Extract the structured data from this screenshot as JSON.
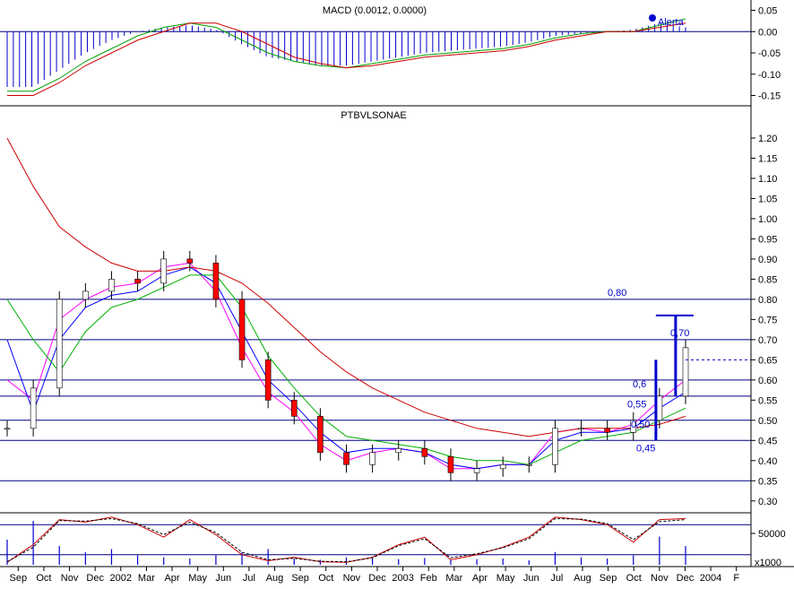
{
  "colors": {
    "background": "#ffffff",
    "frame": "#000000",
    "level_line": "#000080",
    "annotation": "#0000cc",
    "bull_candle": "#ffffff",
    "bear_candle": "#ff0000",
    "ma_fast": "#ff00ff",
    "ma_blue": "#0000ff",
    "ma_green": "#00b000",
    "ma_long": "#cc0000",
    "macd_hist": "#0000cc",
    "macd_line": "#00a000",
    "macd_signal": "#cc0000",
    "stoch_k": "#cc0000",
    "stoch_d": "#000000",
    "volume": "#0000cc"
  },
  "macd_panel": {
    "title": "MACD (0.0012, 0.0000)",
    "legend_marker": "Alerta",
    "axis_ticks": [
      "0.05",
      "0.00",
      "-0.05",
      "-0.10",
      "-0.15"
    ],
    "ylim": [
      -0.17,
      0.07
    ]
  },
  "price_panel": {
    "title": "PTBVLSONAE",
    "axis_ticks": [
      "1.20",
      "1.15",
      "1.10",
      "1.05",
      "1.00",
      "0.95",
      "0.90",
      "0.85",
      "0.80",
      "0.75",
      "0.70",
      "0.65",
      "0.60",
      "0.55",
      "0.50",
      "0.45",
      "0.40",
      "0.35",
      "0.30"
    ],
    "ylim": [
      0.275,
      1.24
    ],
    "annotations": [
      {
        "text": "0,80",
        "y": 0.8,
        "where": "right-of-breakout"
      },
      {
        "text": "0,70",
        "y": 0.7,
        "where": "last-candle"
      },
      {
        "text": "0,45",
        "y": 0.45,
        "where": "below-breakout"
      },
      {
        "text": "0,50",
        "y": 0.5,
        "where": "breakout"
      },
      {
        "text": "0,55",
        "y": 0.55,
        "where": "breakout"
      },
      {
        "text": "0,6",
        "y": 0.6,
        "where": "breakout"
      }
    ]
  },
  "stoch_panel": {
    "axis_ticks": [
      "50000"
    ],
    "multiplier": "x1000"
  },
  "time_axis": {
    "labels": [
      "Sep",
      "Oct",
      "Nov",
      "Dec",
      "2002",
      "Mar",
      "Apr",
      "May",
      "Jun",
      "Jul",
      "Aug",
      "Sep",
      "Oct",
      "Nov",
      "Dec",
      "2003",
      "Feb",
      "Mar",
      "Apr",
      "May",
      "Jun",
      "Jul",
      "Aug",
      "Sep",
      "Oct",
      "Nov",
      "Dec",
      "2004",
      "F"
    ]
  },
  "chart_data": [
    {
      "type": "bar",
      "name": "MACD",
      "x": [
        "2001-09",
        "2001-10",
        "2001-11",
        "2001-12",
        "2002-01",
        "2002-02",
        "2002-03",
        "2002-04",
        "2002-05",
        "2002-06",
        "2002-07",
        "2002-08",
        "2002-09",
        "2002-10",
        "2002-11",
        "2002-12",
        "2003-01",
        "2003-02",
        "2003-03",
        "2003-04",
        "2003-05",
        "2003-06",
        "2003-07",
        "2003-08",
        "2003-09",
        "2003-10",
        "2003-11"
      ],
      "series": [
        {
          "values": [
            -0.13,
            -0.13,
            -0.09,
            -0.05,
            -0.02,
            0.0,
            0.01,
            0.015,
            0.005,
            -0.03,
            -0.06,
            -0.07,
            -0.08,
            -0.08,
            -0.07,
            -0.06,
            -0.05,
            -0.045,
            -0.04,
            -0.035,
            -0.025,
            -0.01,
            -0.005,
            0.0,
            0.005,
            0.02,
            0.01
          ]
        },
        {
          "values": [
            -0.14,
            -0.14,
            -0.11,
            -0.07,
            -0.04,
            -0.01,
            0.01,
            0.02,
            0.01,
            -0.02,
            -0.05,
            -0.07,
            -0.08,
            -0.085,
            -0.075,
            -0.065,
            -0.055,
            -0.05,
            -0.045,
            -0.04,
            -0.03,
            -0.015,
            -0.005,
            0.0,
            0.0,
            0.015,
            0.03
          ]
        },
        {
          "values": [
            -0.15,
            -0.15,
            -0.12,
            -0.08,
            -0.05,
            -0.02,
            0.0,
            0.02,
            0.02,
            0.0,
            -0.03,
            -0.06,
            -0.075,
            -0.085,
            -0.08,
            -0.07,
            -0.06,
            -0.055,
            -0.05,
            -0.045,
            -0.035,
            -0.02,
            -0.01,
            0.0,
            0.0,
            0.01,
            0.02
          ]
        }
      ]
    },
    {
      "type": "line",
      "name": "PTBVLSONAE",
      "x": [
        "2001-09",
        "2001-10",
        "2001-11",
        "2001-12",
        "2002-01",
        "2002-02",
        "2002-03",
        "2002-04",
        "2002-05",
        "2002-06",
        "2002-07",
        "2002-08",
        "2002-09",
        "2002-10",
        "2002-11",
        "2002-12",
        "2003-01",
        "2003-02",
        "2003-03",
        "2003-04",
        "2003-05",
        "2003-06",
        "2003-07",
        "2003-08",
        "2003-09",
        "2003-10",
        "2003-11"
      ],
      "series": [
        {
          "name": "",
          "values": [
            0.48,
            0.58,
            0.8,
            0.82,
            0.85,
            0.84,
            0.9,
            0.89,
            0.8,
            0.65,
            0.55,
            0.51,
            0.42,
            0.39,
            0.42,
            0.43,
            0.41,
            0.37,
            0.38,
            0.39,
            0.39,
            0.48,
            0.48,
            0.47,
            0.5,
            0.56,
            0.68
          ]
        },
        {
          "values": [
            0.6,
            0.55,
            0.75,
            0.8,
            0.83,
            0.84,
            0.88,
            0.89,
            0.82,
            0.68,
            0.57,
            0.52,
            0.44,
            0.4,
            0.42,
            0.43,
            0.42,
            0.38,
            0.38,
            0.39,
            0.39,
            0.47,
            0.48,
            0.47,
            0.49,
            0.55,
            0.6
          ]
        },
        {
          "values": [
            0.7,
            0.52,
            0.7,
            0.78,
            0.81,
            0.82,
            0.86,
            0.88,
            0.84,
            0.72,
            0.6,
            0.54,
            0.47,
            0.42,
            0.43,
            0.43,
            0.42,
            0.39,
            0.38,
            0.39,
            0.39,
            0.45,
            0.47,
            0.47,
            0.48,
            0.53,
            0.57
          ]
        },
        {
          "values": [
            0.8,
            0.7,
            0.62,
            0.72,
            0.78,
            0.8,
            0.83,
            0.86,
            0.86,
            0.78,
            0.66,
            0.58,
            0.51,
            0.46,
            0.45,
            0.44,
            0.43,
            0.41,
            0.4,
            0.4,
            0.39,
            0.42,
            0.45,
            0.46,
            0.47,
            0.5,
            0.53
          ]
        },
        {
          "values": [
            1.2,
            1.08,
            0.98,
            0.93,
            0.89,
            0.87,
            0.87,
            0.88,
            0.87,
            0.84,
            0.79,
            0.73,
            0.67,
            0.62,
            0.58,
            0.55,
            0.52,
            0.5,
            0.48,
            0.47,
            0.46,
            0.47,
            0.48,
            0.48,
            0.48,
            0.49,
            0.51
          ]
        }
      ],
      "levels": [
        0.8,
        0.7,
        0.6,
        0.56,
        0.5,
        0.45,
        0.35
      ],
      "ylim": [
        0.275,
        1.24
      ]
    },
    {
      "type": "line",
      "name": "Stochastic",
      "x": [
        "2001-09",
        "2001-10",
        "2001-11",
        "2001-12",
        "2002-01",
        "2002-02",
        "2002-03",
        "2002-04",
        "2002-05",
        "2002-06",
        "2002-07",
        "2002-08",
        "2002-09",
        "2002-10",
        "2002-11",
        "2002-12",
        "2003-01",
        "2003-02",
        "2003-03",
        "2003-04",
        "2003-05",
        "2003-06",
        "2003-07",
        "2003-08",
        "2003-09",
        "2003-10",
        "2003-11"
      ],
      "series": [
        {
          "values": [
            5,
            40,
            90,
            85,
            95,
            80,
            55,
            90,
            60,
            20,
            8,
            15,
            6,
            5,
            15,
            40,
            55,
            10,
            20,
            35,
            55,
            95,
            90,
            80,
            45,
            90,
            92
          ]
        },
        {
          "values": [
            6,
            35,
            88,
            87,
            92,
            82,
            60,
            85,
            64,
            25,
            10,
            13,
            7,
            6,
            14,
            38,
            52,
            14,
            22,
            34,
            52,
            92,
            91,
            82,
            50,
            86,
            90
          ]
        }
      ],
      "ylim": [
        0,
        100
      ]
    },
    {
      "type": "bar",
      "name": "Volume",
      "x": [
        "2001-09",
        "2001-10",
        "2001-11",
        "2001-12",
        "2002-01",
        "2002-02",
        "2002-03",
        "2002-04",
        "2002-05",
        "2002-06",
        "2002-07",
        "2002-08",
        "2002-09",
        "2002-10",
        "2002-11",
        "2002-12",
        "2003-01",
        "2003-02",
        "2003-03",
        "2003-04",
        "2003-05",
        "2003-06",
        "2003-07",
        "2003-08",
        "2003-09",
        "2003-10",
        "2003-11"
      ],
      "values": [
        40000,
        70000,
        30000,
        20000,
        25000,
        15000,
        12000,
        10000,
        15000,
        20000,
        25000,
        10000,
        8000,
        12000,
        10000,
        9000,
        11000,
        8000,
        9000,
        10000,
        7000,
        20000,
        12000,
        10000,
        15000,
        45000,
        30000
      ],
      "ylim": [
        0,
        80000
      ]
    }
  ]
}
